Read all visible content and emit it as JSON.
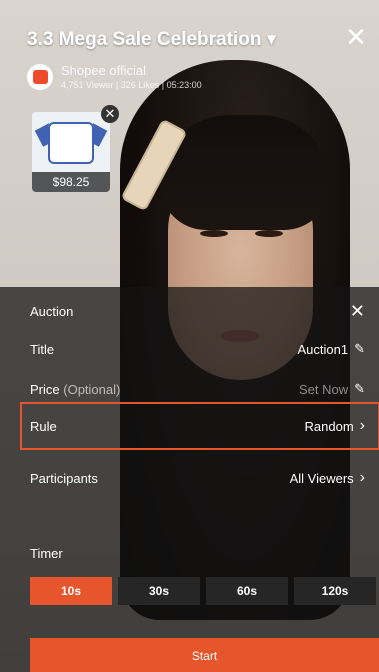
{
  "stream": {
    "title": "3.3 Mega Sale Celebration ▾",
    "close_icon": "close-icon",
    "shop_name": "Shopee official",
    "stats": "4,751 Viewer | 326 Likes | 05:23:00",
    "product_price": "$98.25"
  },
  "auction_panel": {
    "header": "Auction",
    "title_label": "Title",
    "title_value": "Auction1",
    "price_label": "Price",
    "price_optional": "(Optional)",
    "price_value": "Set Now",
    "rule_label": "Rule",
    "rule_value": "Random",
    "participants_label": "Participants",
    "participants_value": "All Viewers",
    "timer_label": "Timer",
    "timer_options": [
      "10s",
      "30s",
      "60s",
      "120s"
    ],
    "timer_selected": "10s",
    "start_label": "Start"
  },
  "colors": {
    "accent": "#e7552c",
    "panel": "#141414"
  }
}
